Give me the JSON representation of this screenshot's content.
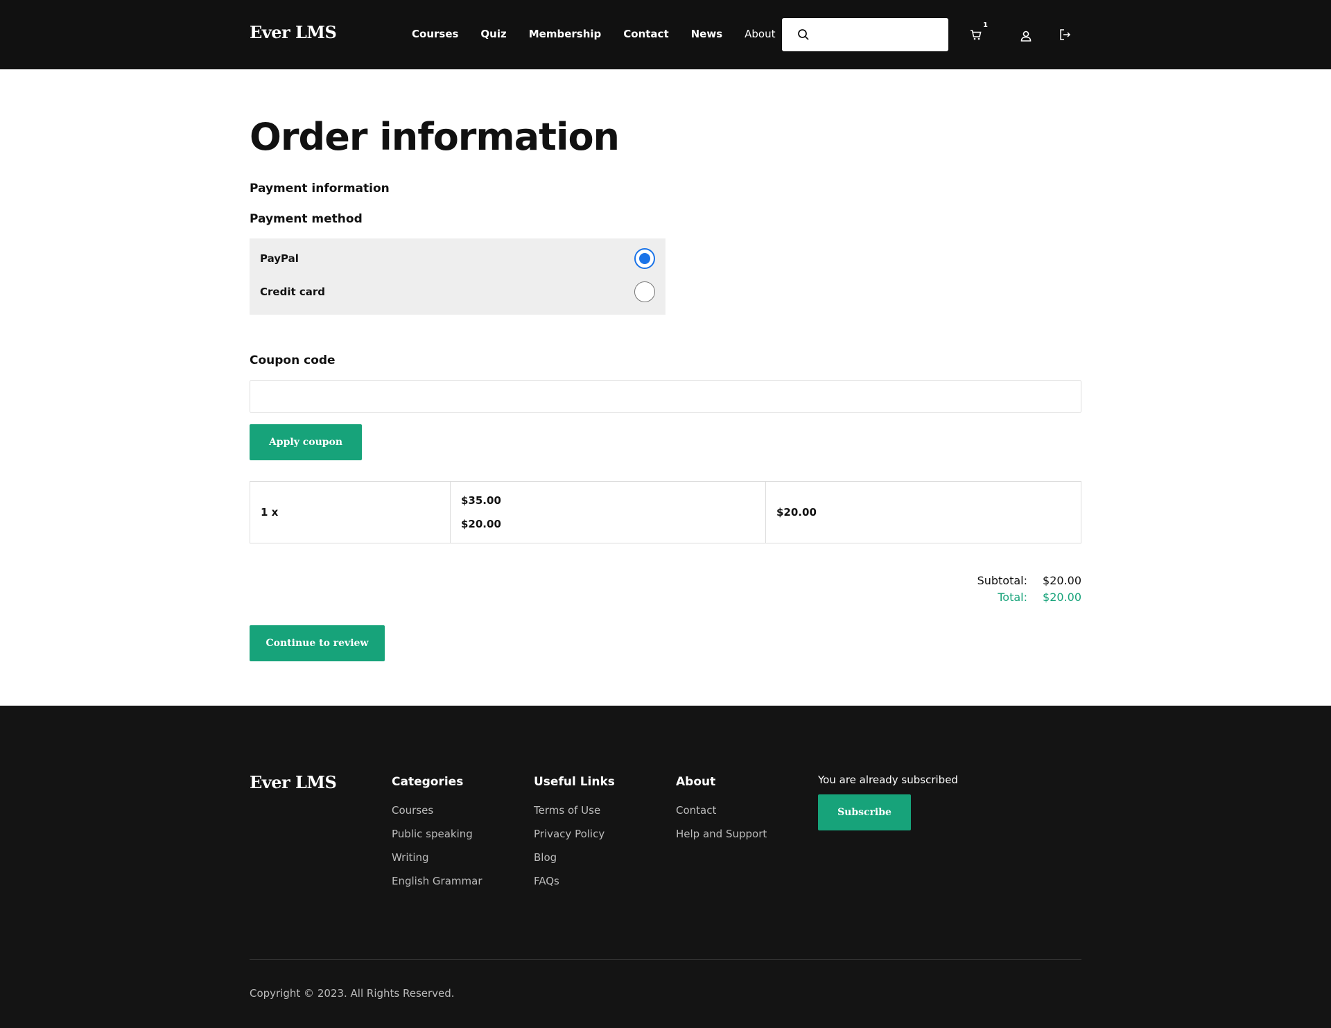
{
  "header": {
    "brand": "Ever LMS",
    "nav": [
      "Courses",
      "Quiz",
      "Membership",
      "Contact",
      "News"
    ],
    "about_label": "About",
    "search_placeholder": "",
    "cart_count": "1"
  },
  "main": {
    "title": "Order information",
    "payment_info_label": "Payment information",
    "payment_method_label": "Payment method",
    "payment_options": [
      {
        "label": "PayPal",
        "selected": true
      },
      {
        "label": "Credit card",
        "selected": false
      }
    ],
    "coupon_label": "Coupon code",
    "coupon_value": "",
    "apply_coupon_label": "Apply coupon",
    "order_row": {
      "quantity": "1 x",
      "original_price": "$35.00",
      "sale_price": "$20.00",
      "line_total": "$20.00"
    },
    "subtotal_label": "Subtotal:",
    "subtotal_value": "$20.00",
    "total_label": "Total:",
    "total_value": "$20.00",
    "continue_label": "Continue to review"
  },
  "footer": {
    "brand": "Ever LMS",
    "categories": {
      "title": "Categories",
      "links": [
        "Courses",
        "Public speaking",
        "Writing",
        "English Grammar"
      ]
    },
    "useful_links": {
      "title": "Useful Links",
      "links": [
        "Terms of Use",
        "Privacy Policy",
        "Blog",
        "FAQs"
      ]
    },
    "about": {
      "title": "About",
      "links": [
        "Contact",
        "Help and Support"
      ]
    },
    "subscribe_text": "You are already subscribed",
    "subscribe_label": "Subscribe",
    "copyright": "Copyright © 2023. All Rights Reserved."
  },
  "colors": {
    "accent": "#17a37a",
    "header_bg": "#111111",
    "footer_bg": "#141414",
    "radio_selected": "#1a73e8"
  },
  "icons": [
    "search-icon",
    "chevron-down-icon",
    "cart-icon",
    "user-icon",
    "logout-icon"
  ]
}
